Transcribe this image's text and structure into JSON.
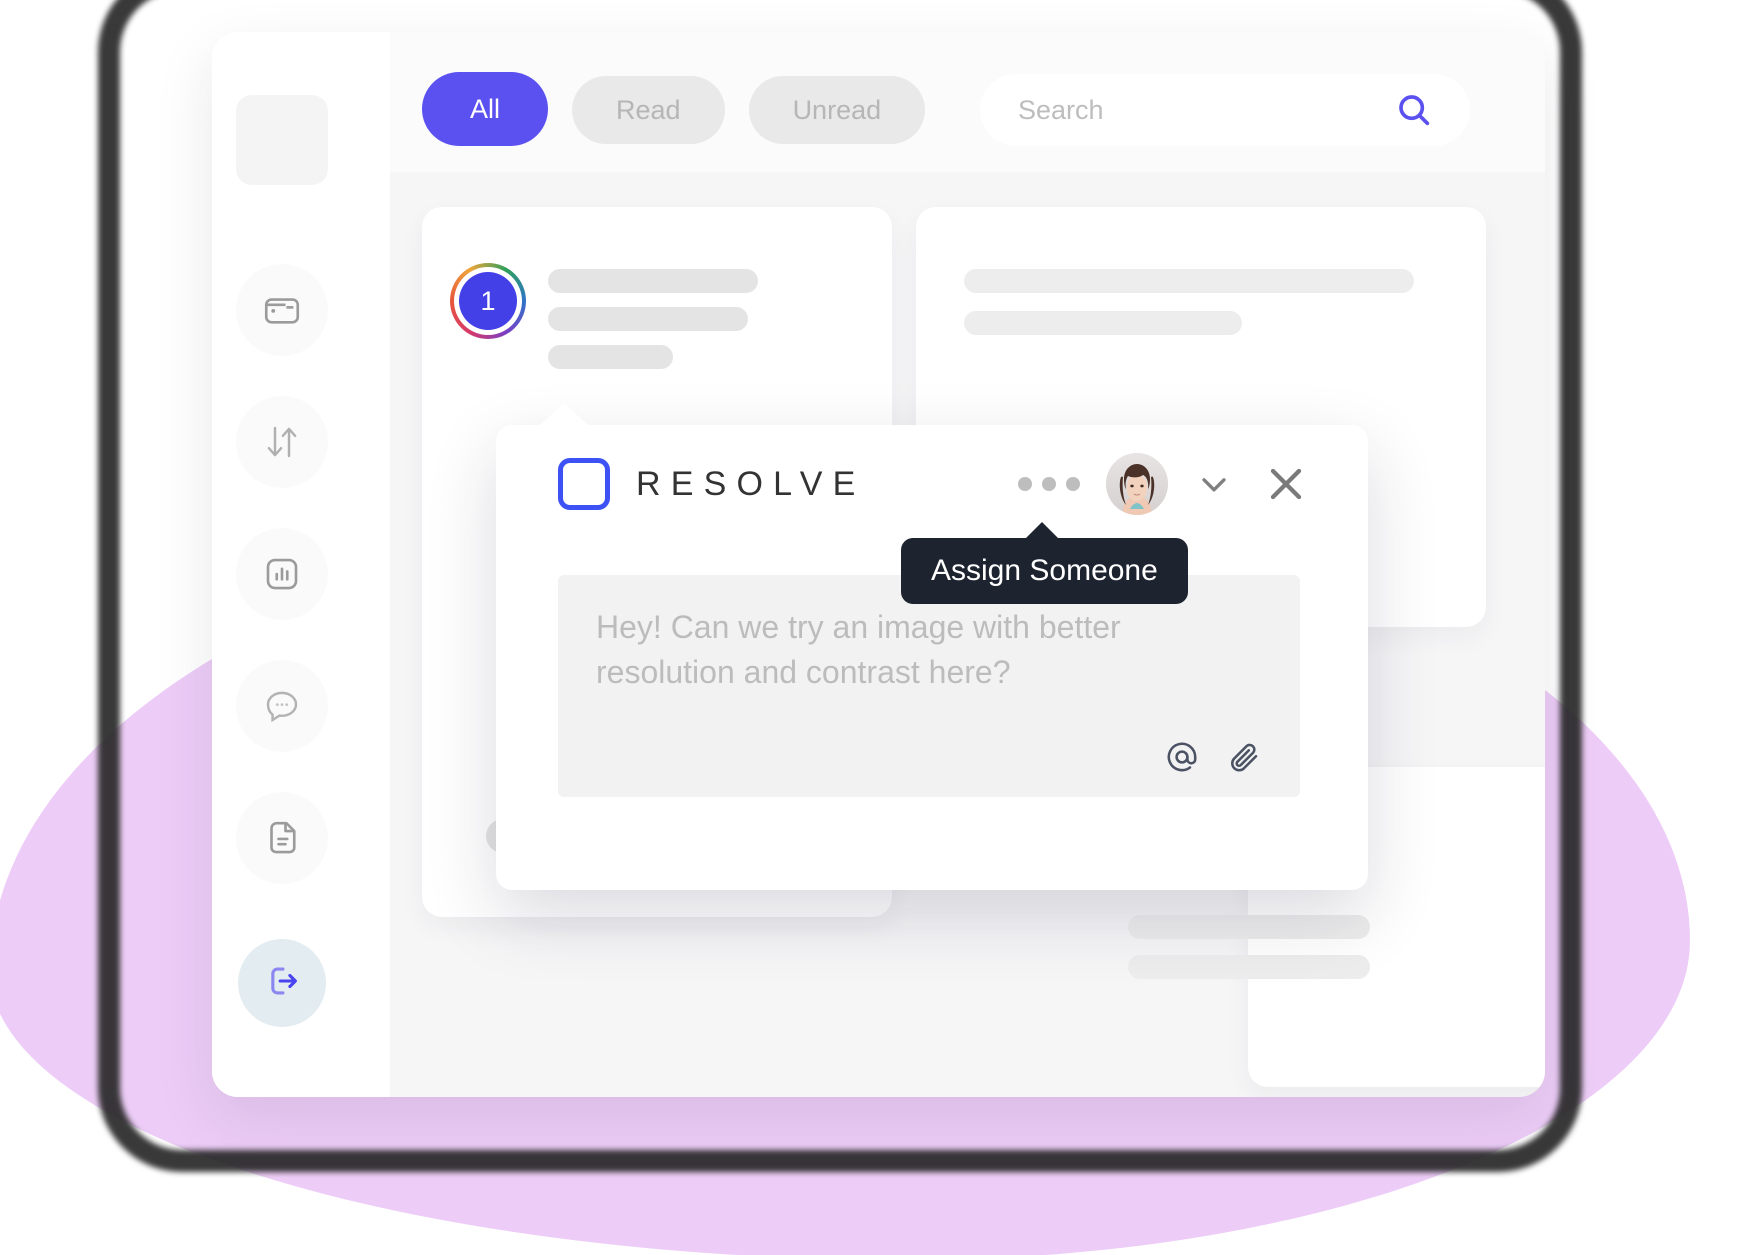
{
  "app": {
    "sidebar": {
      "logo_placeholder": "",
      "items": [
        {
          "icon": "wallet-icon",
          "name": "wallet"
        },
        {
          "icon": "transfer-icon",
          "name": "transfer"
        },
        {
          "icon": "analytics-icon",
          "name": "analytics"
        },
        {
          "icon": "chat-icon",
          "name": "chat"
        },
        {
          "icon": "document-icon",
          "name": "document"
        }
      ],
      "logout": {
        "icon": "logout-icon",
        "label": "Log out"
      }
    },
    "topbar": {
      "filters": [
        {
          "label": "All",
          "active": true
        },
        {
          "label": "Read",
          "active": false
        },
        {
          "label": "Unread",
          "active": false
        }
      ],
      "search": {
        "value": "",
        "placeholder": "Search",
        "icon": "search-icon"
      }
    },
    "content": {
      "card_one": {
        "badge_count": "1"
      },
      "card_two": {},
      "card_three": {}
    }
  },
  "modal": {
    "brand": "RESOLVE",
    "logo_icon": "square-outline-icon",
    "more_icon": "more-horizontal-icon",
    "avatar_icon": "avatar",
    "chevron_icon": "chevron-down-icon",
    "close_icon": "close-icon",
    "tooltip": "Assign Someone",
    "composer": {
      "text": "Hey! Can we try an image with better resolution and contrast here?",
      "mention_icon": "at-mention-icon",
      "attach_icon": "paperclip-icon"
    }
  },
  "colors": {
    "accent": "#5b51f0",
    "brand_blue": "#3d52f5",
    "badge": "#4340e8",
    "tooltip_bg": "#1d2430",
    "blob": "#edcdf7"
  }
}
